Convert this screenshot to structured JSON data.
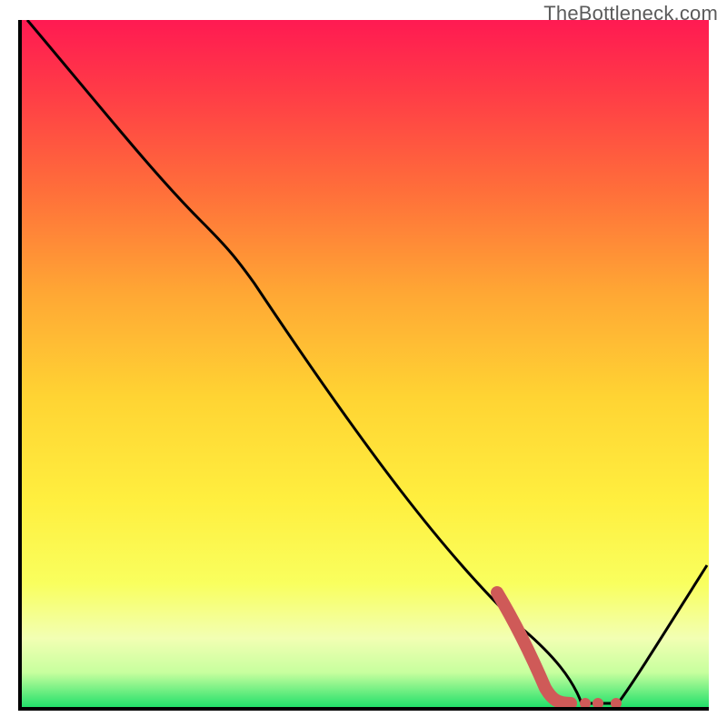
{
  "watermark": "TheBottleneck.com",
  "colors": {
    "gradient_top": "#ff1a52",
    "gradient_mid": "#ffd433",
    "gradient_bottom": "#22e06a",
    "curve": "#000000",
    "highlight": "#cf5a58",
    "axis": "#000000"
  },
  "chart_data": {
    "type": "line",
    "title": "",
    "xlabel": "",
    "ylabel": "",
    "xlim": [
      0,
      100
    ],
    "ylim": [
      0,
      100
    ],
    "grid": false,
    "legend": false,
    "series": [
      {
        "name": "bottleneck_curve",
        "x": [
          0,
          10,
          20,
          26,
          34,
          46,
          60,
          73,
          80,
          82,
          87,
          100
        ],
        "y": [
          100,
          88,
          76,
          71,
          62,
          41,
          20,
          12,
          1,
          1,
          1,
          21
        ],
        "note": "y read as percent up from x-axis; curve drops steeply, flattens near the bottom around x≈80–87, then rises."
      },
      {
        "name": "highlighted_optimum",
        "x": [
          70,
          74,
          77,
          80,
          82,
          84,
          87
        ],
        "y": [
          17,
          10,
          5,
          2,
          1,
          1,
          1
        ],
        "style": "thick-then-dotted",
        "note": "bold red segment marking the region of minimum bottleneck."
      }
    ],
    "background": {
      "type": "vertical_gradient",
      "meaning": "red=high bottleneck, green=low bottleneck",
      "stops": [
        {
          "pos": 0.0,
          "color": "#ff1a52"
        },
        {
          "pos": 0.55,
          "color": "#ffd433"
        },
        {
          "pos": 0.9,
          "color": "#f2ffb3"
        },
        {
          "pos": 1.0,
          "color": "#22e06a"
        }
      ]
    }
  }
}
